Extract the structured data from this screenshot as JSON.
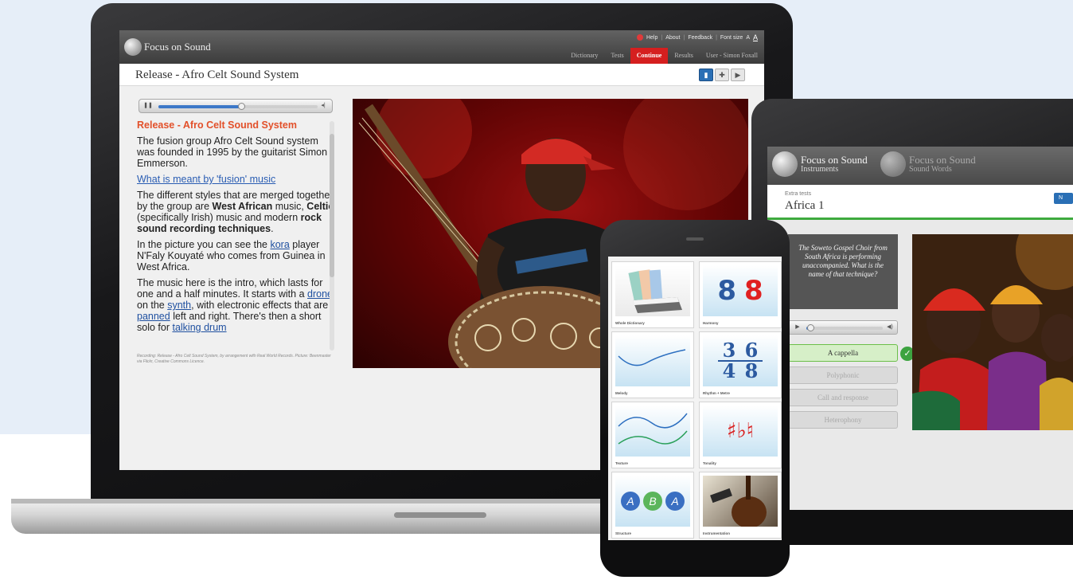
{
  "colors": {
    "accent_red": "#d51f1f",
    "heading_orange": "#e2502a",
    "link_blue": "#1f50a0",
    "correct_green": "#3da340",
    "next_blue": "#2a6fb5"
  },
  "laptop": {
    "logo": "Focus on Sound",
    "util": {
      "help": "Help",
      "about": "About",
      "feedback": "Feedback",
      "font_size": "Font size",
      "font_a_small": "A",
      "font_a_large": "A"
    },
    "nav": [
      {
        "label": "Dictionary"
      },
      {
        "label": "Tests"
      },
      {
        "label": "Continue",
        "active": true
      },
      {
        "label": "Results"
      },
      {
        "label": "User - Simon Foxall"
      }
    ],
    "page_title": "Release - Afro Celt Sound System",
    "view_icons": [
      "book-icon",
      "plus-icon",
      "video-icon"
    ],
    "player": {
      "progress": 0.52
    },
    "text": {
      "heading": "Release - Afro Celt Sound System",
      "p1": "The fusion group Afro Celt Sound system was founded in 1995 by the guitarist Simon Emmerson.",
      "question_link": "What is meant by 'fusion' music",
      "p2_a": "The different styles that are merged together by the group are ",
      "p2_b1": "West African",
      "p2_c": " music, ",
      "p2_b2": "Celtic",
      "p2_d": " (specifically Irish) music and modern ",
      "p2_b3": "rock sound recording techniques",
      "p2_e": ".",
      "p3_a": "In the picture you can see the ",
      "p3_link": "kora",
      "p3_b": " player N'Faly Kouyaté who comes from Guinea in West Africa.",
      "p4_a": "The music here is the intro, which lasts for one and a half minutes. It starts with a ",
      "p4_link1": "drone",
      "p4_b": " on the ",
      "p4_link2": "synth",
      "p4_c": ", with electronic effects that are ",
      "p4_link3": "panned",
      "p4_d": " left and right. There's then a short solo for ",
      "p4_link4": "talking drum"
    },
    "caption": "Recording: Release - Afro Celt Sound System, by arrangement with Real World Records. Picture: Beenmaster via Flickr, Creative Commons Licence."
  },
  "tablet": {
    "logo1": {
      "name": "Focus on Sound",
      "sub": "Instruments"
    },
    "logo2": {
      "name": "Focus on Sound",
      "sub": "Sound Words"
    },
    "subtitle": "Extra tests",
    "title": "Africa 1",
    "next": "N",
    "question": "The Soweto Gospel Choir from South Africa is performing unaccompanied. What is the name of that technique?",
    "player": {
      "progress": 0.05
    },
    "answers": [
      {
        "label": "A cappella",
        "correct": true
      },
      {
        "label": "Polyphonic"
      },
      {
        "label": "Call and response"
      },
      {
        "label": "Heterophony"
      }
    ]
  },
  "phone": {
    "tiles": [
      {
        "label": "Whole Dictionary",
        "icon": "books-icon"
      },
      {
        "label": "Harmony",
        "icon": "harmony-icon"
      },
      {
        "label": "Melody",
        "icon": "melody-icon"
      },
      {
        "label": "Rhythm + Metre",
        "icon": "time-signature-icon"
      },
      {
        "label": "Texture",
        "icon": "texture-icon"
      },
      {
        "label": "Tonality",
        "icon": "accidentals-icon"
      },
      {
        "label": "Structure",
        "icon": "aba-icon"
      },
      {
        "label": "Instrumentation",
        "icon": "double-bass-icon"
      }
    ],
    "harmony_digits": [
      "8",
      "8"
    ],
    "rhythm_top": [
      "3",
      "6"
    ],
    "rhythm_bottom": [
      "4",
      "8"
    ],
    "tonality_glyphs": "♯♭♮",
    "structure_letters": [
      "A",
      "B",
      "A"
    ]
  }
}
